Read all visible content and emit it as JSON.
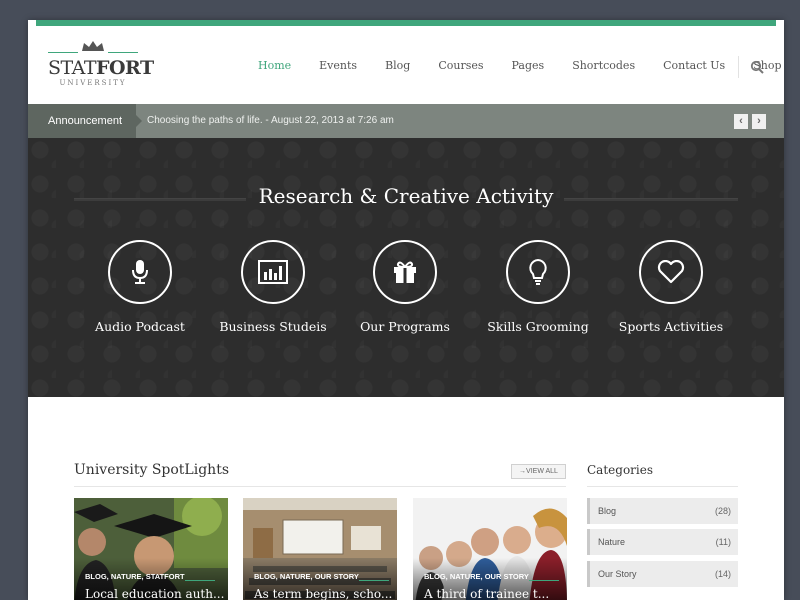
{
  "brand": {
    "name_light": "STAT",
    "name_bold": "FORT",
    "tagline": "UNIVERSITY",
    "accent": "#3fa67c"
  },
  "nav": {
    "items": [
      "Home",
      "Events",
      "Blog",
      "Courses",
      "Pages",
      "Shortcodes",
      "Contact Us",
      "Shop"
    ],
    "active": "Home",
    "search_icon": "search-icon"
  },
  "announcement": {
    "label": "Announcement",
    "text": "Choosing the paths of life. - August 22, 2013 at 7:26 am",
    "prev_icon": "chevron-left-icon",
    "next_icon": "chevron-right-icon"
  },
  "hero": {
    "title": "Research & Creative Activity",
    "features": [
      {
        "label": "Audio Podcast",
        "icon": "microphone-icon"
      },
      {
        "label": "Business Studeis",
        "icon": "bar-chart-icon"
      },
      {
        "label": "Our Programs",
        "icon": "gift-icon"
      },
      {
        "label": "Skills Grooming",
        "icon": "lightbulb-icon"
      },
      {
        "label": "Sports Activities",
        "icon": "heart-icon"
      }
    ]
  },
  "spotlights": {
    "title": "University SpotLights",
    "view_all": "→VIEW ALL",
    "cards": [
      {
        "categories": "BLOG, NATURE, STATFORT",
        "title": "Local education auth..."
      },
      {
        "categories": "BLOG, NATURE, OUR STORY",
        "title": "As term begins, scho..."
      },
      {
        "categories": "BLOG, NATURE, OUR STORY",
        "title": "A third of trainee t..."
      }
    ]
  },
  "categories": {
    "title": "Categories",
    "items": [
      {
        "name": "Blog",
        "count": "(28)"
      },
      {
        "name": "Nature",
        "count": "(11)"
      },
      {
        "name": "Our Story",
        "count": "(14)"
      }
    ]
  }
}
